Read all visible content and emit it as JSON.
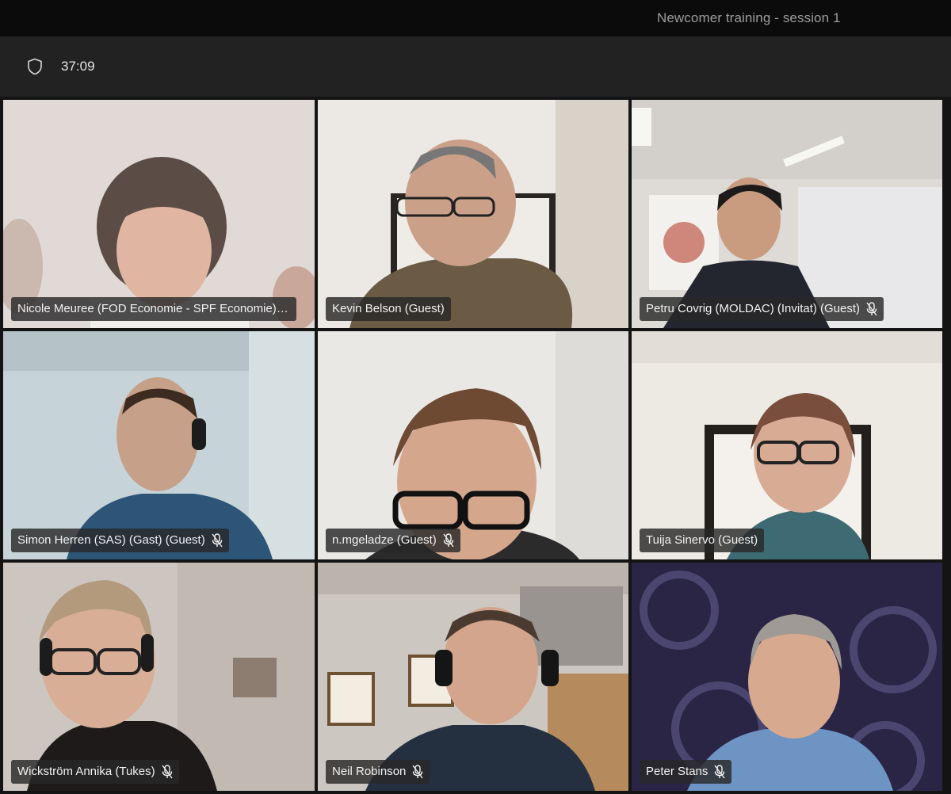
{
  "window": {
    "title": "Newcomer training - session 1"
  },
  "toolbar": {
    "timer": "37:09",
    "security_icon": "shield-icon"
  },
  "participants": [
    {
      "name": "Nicole Meuree (FOD Economie - SPF Economie) (G...",
      "muted": false
    },
    {
      "name": "Kevin Belson (Guest)",
      "muted": false
    },
    {
      "name": "Petru Covrig (MOLDAC) (Invitat) (Guest)",
      "muted": true
    },
    {
      "name": "Simon Herren (SAS) (Gast) (Guest)",
      "muted": true
    },
    {
      "name": "n.mgeladze (Guest)",
      "muted": true
    },
    {
      "name": "Tuija Sinervo (Guest)",
      "muted": false
    },
    {
      "name": "Wickström Annika (Tukes)",
      "muted": true
    },
    {
      "name": "Neil Robinson",
      "muted": true
    },
    {
      "name": "Peter Stans",
      "muted": true
    }
  ],
  "colors": {
    "titlebar": "#0b0b0b",
    "toolbar": "#222222",
    "label_bg": "#282828",
    "text": "#f2f2f2"
  }
}
